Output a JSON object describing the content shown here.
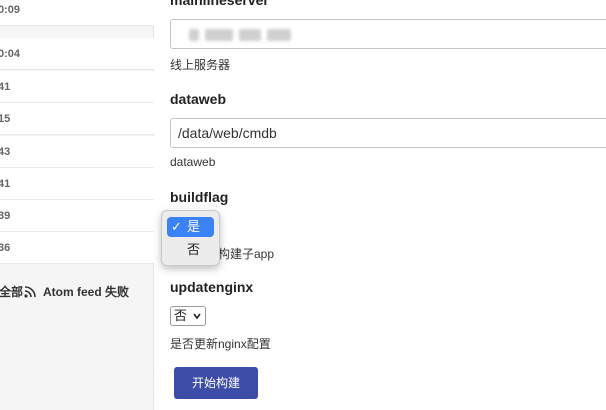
{
  "builds": [
    {
      "time": "0:09"
    },
    {
      "time": "0:04"
    },
    {
      "time": "41"
    },
    {
      "time": "15"
    },
    {
      "time": "43"
    },
    {
      "time": "41"
    },
    {
      "time": "39"
    },
    {
      "time": "36"
    }
  ],
  "feeds": {
    "all_label": "全部",
    "fail_label": "Atom feed 失败"
  },
  "params": {
    "mainlineserver": {
      "name": "mainlineserver",
      "desc": "线上服务器"
    },
    "dataweb": {
      "name": "dataweb",
      "value": "/data/web/cmdb",
      "desc": "dataweb"
    },
    "buildflag": {
      "name": "buildflag",
      "desc_suffix": "构建子app"
    },
    "updatenginx": {
      "name": "updatenginx",
      "value": "否",
      "desc": "是否更新nginx配置"
    }
  },
  "dropdown": {
    "options": [
      "是",
      "否"
    ],
    "selected": "是",
    "check": "✓"
  },
  "build_button": "开始构建",
  "colors": {
    "button": "#3d4ca6",
    "selected_option": "#3b82f6"
  }
}
